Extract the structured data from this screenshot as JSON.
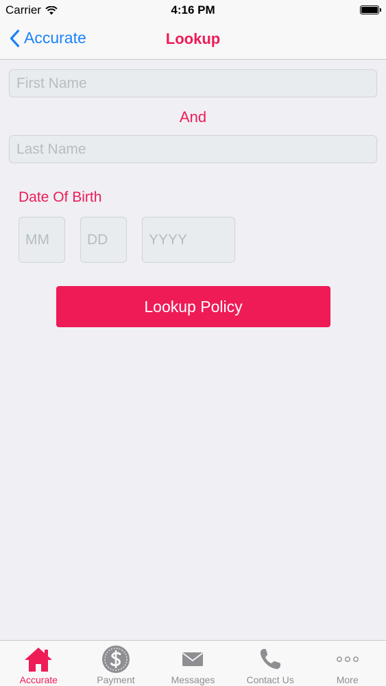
{
  "status_bar": {
    "carrier": "Carrier",
    "time": "4:16 PM"
  },
  "nav": {
    "back_label": "Accurate",
    "title": "Lookup"
  },
  "form": {
    "first_name": {
      "value": "",
      "placeholder": "First Name"
    },
    "and_label": "And",
    "last_name": {
      "value": "",
      "placeholder": "Last Name"
    },
    "dob_label": "Date Of Birth",
    "dob_month": {
      "value": "",
      "placeholder": "MM"
    },
    "dob_day": {
      "value": "",
      "placeholder": "DD"
    },
    "dob_year": {
      "value": "",
      "placeholder": "YYYY"
    },
    "submit_label": "Lookup Policy"
  },
  "tabs": [
    {
      "label": "Accurate",
      "icon": "home-icon",
      "active": true
    },
    {
      "label": "Payment",
      "icon": "dollar-coin-icon",
      "active": false
    },
    {
      "label": "Messages",
      "icon": "envelope-icon",
      "active": false
    },
    {
      "label": "Contact Us",
      "icon": "phone-icon",
      "active": false
    },
    {
      "label": "More",
      "icon": "more-dots-icon",
      "active": false
    }
  ],
  "colors": {
    "accent": "#ee1b56",
    "link": "#1a82fb",
    "tab_inactive": "#8e8e93",
    "background": "#efeff4"
  }
}
